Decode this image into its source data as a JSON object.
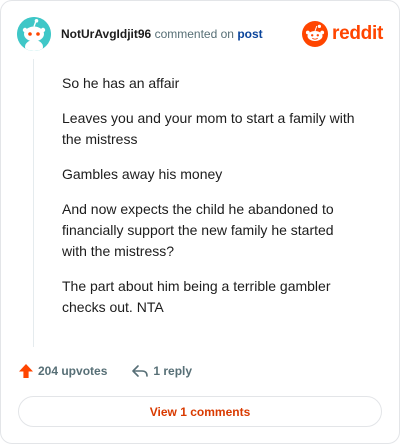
{
  "header": {
    "username": "NotUrAvgIdjit96",
    "commented_text": "commented on",
    "post_link": "post"
  },
  "logo": {
    "wordmark": "reddit",
    "icon": "reddit-snoo-icon"
  },
  "comment": {
    "paragraphs": [
      "So he has an affair",
      "Leaves you and your mom to start a family with the mistress",
      "Gambles away his money",
      "And now expects the child he abandoned to financially support the new family he started with the mistress?",
      "The part about him being a terrible gambler checks out. NTA"
    ]
  },
  "actions": {
    "upvotes_label": "204 upvotes",
    "reply_label": "1 reply"
  },
  "view_comments_label": "View 1 comments",
  "colors": {
    "brand": "#ff4500",
    "link": "#0a449b",
    "view_button_text": "#d93a00",
    "avatar_bg": "#3fc7c7"
  }
}
